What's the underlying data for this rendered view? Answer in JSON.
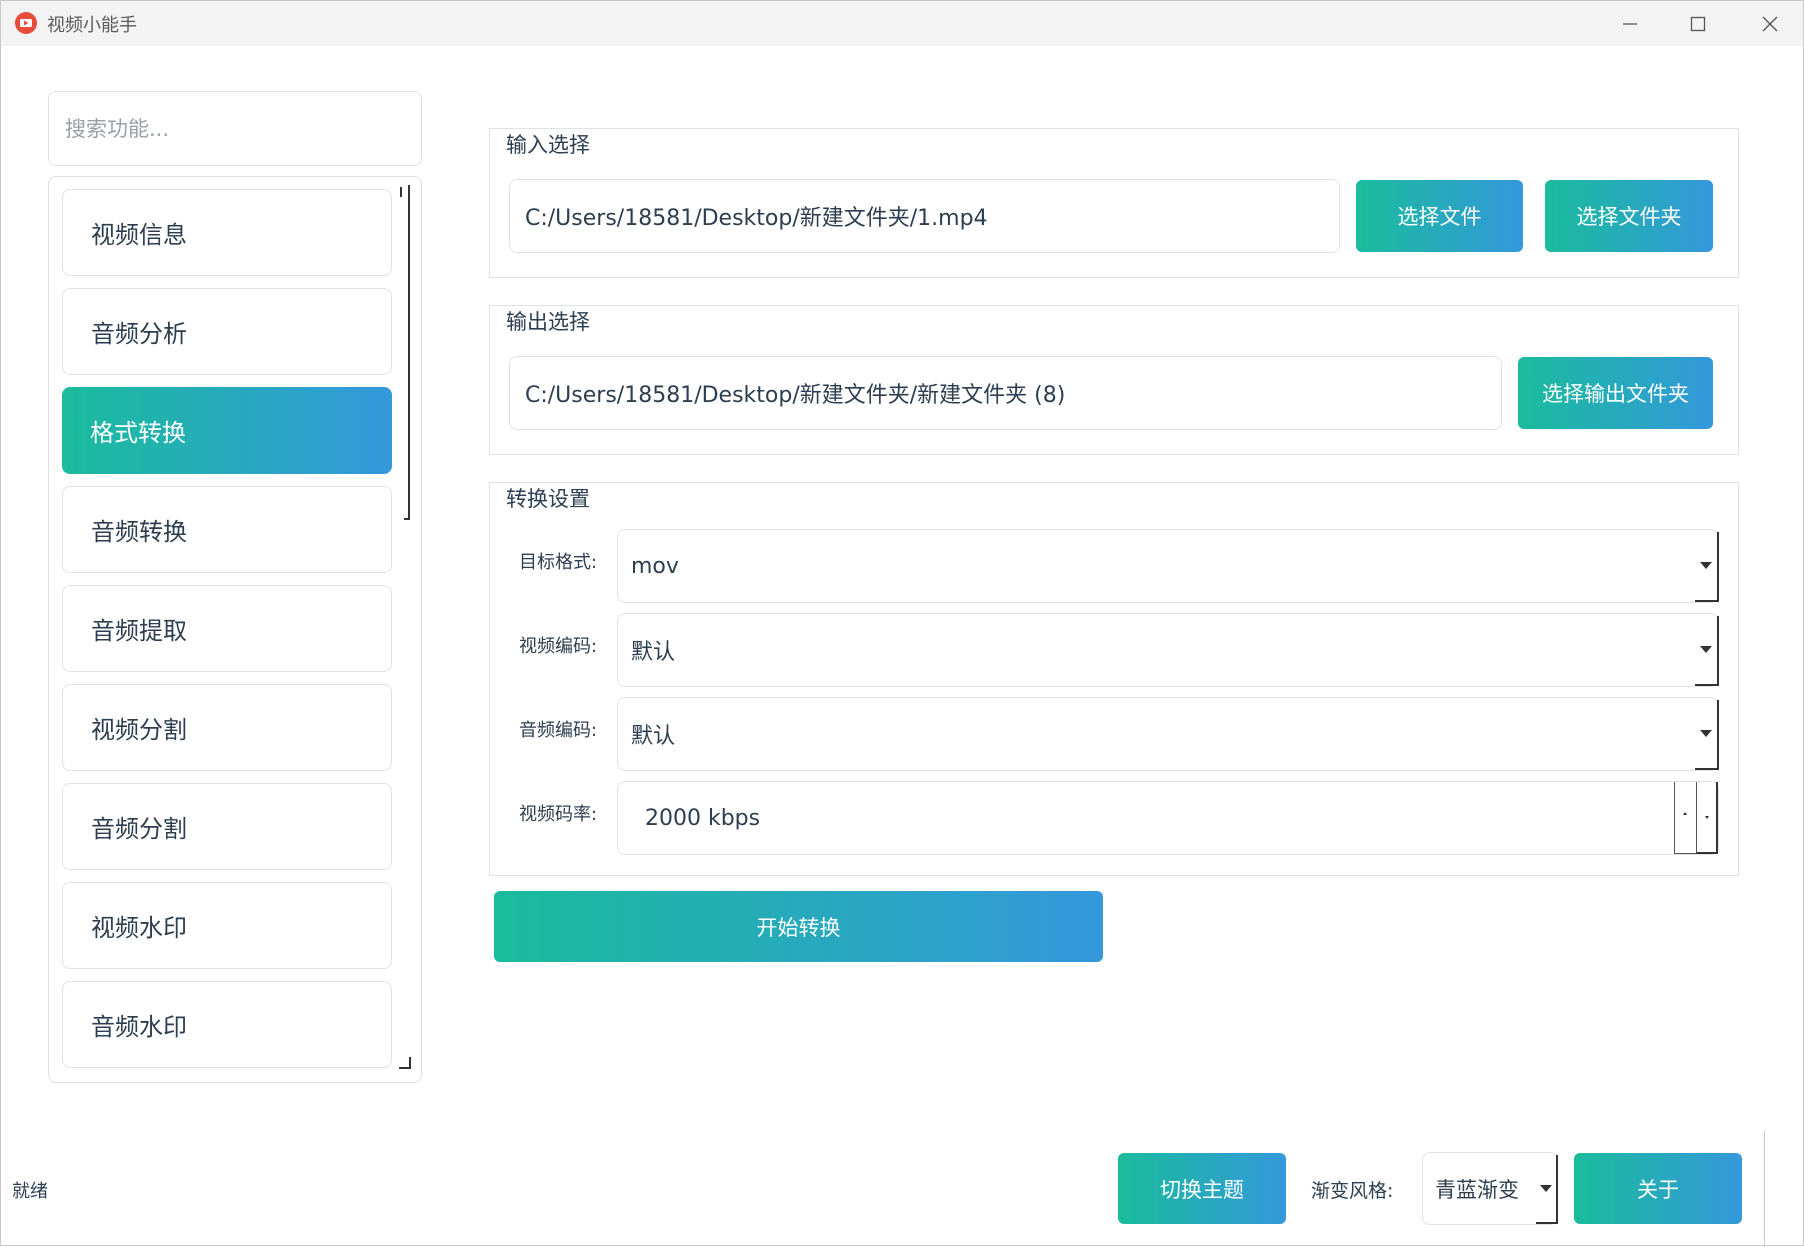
{
  "window": {
    "title": "视频小能手"
  },
  "sidebar": {
    "search_placeholder": "搜索功能...",
    "items": [
      {
        "label": "视频信息"
      },
      {
        "label": "音频分析"
      },
      {
        "label": "格式转换",
        "active": true
      },
      {
        "label": "音频转换"
      },
      {
        "label": "音频提取"
      },
      {
        "label": "视频分割"
      },
      {
        "label": "音频分割"
      },
      {
        "label": "视频水印"
      },
      {
        "label": "音频水印"
      }
    ]
  },
  "input_group": {
    "title": "输入选择",
    "path": "C:/Users/18581/Desktop/新建文件夹/1.mp4",
    "select_file_label": "选择文件",
    "select_folder_label": "选择文件夹"
  },
  "output_group": {
    "title": "输出选择",
    "path": "C:/Users/18581/Desktop/新建文件夹/新建文件夹 (8)",
    "select_output_label": "选择输出文件夹"
  },
  "convert_group": {
    "title": "转换设置",
    "target_format_label": "目标格式:",
    "target_format_value": "mov",
    "video_codec_label": "视频编码:",
    "video_codec_value": "默认",
    "audio_codec_label": "音频编码:",
    "audio_codec_value": "默认",
    "video_bitrate_label": "视频码率:",
    "video_bitrate_value": "2000 kbps"
  },
  "start_button_label": "开始转换",
  "bottom_bar": {
    "status": "就绪",
    "switch_theme_label": "切换主题",
    "gradient_style_label": "渐变风格:",
    "gradient_style_value": "青蓝渐变",
    "about_label": "关于"
  },
  "colors": {
    "gradient_start": "#1abc9c",
    "gradient_end": "#3498db",
    "text": "#2c3e50",
    "border": "#dfe3e7"
  }
}
